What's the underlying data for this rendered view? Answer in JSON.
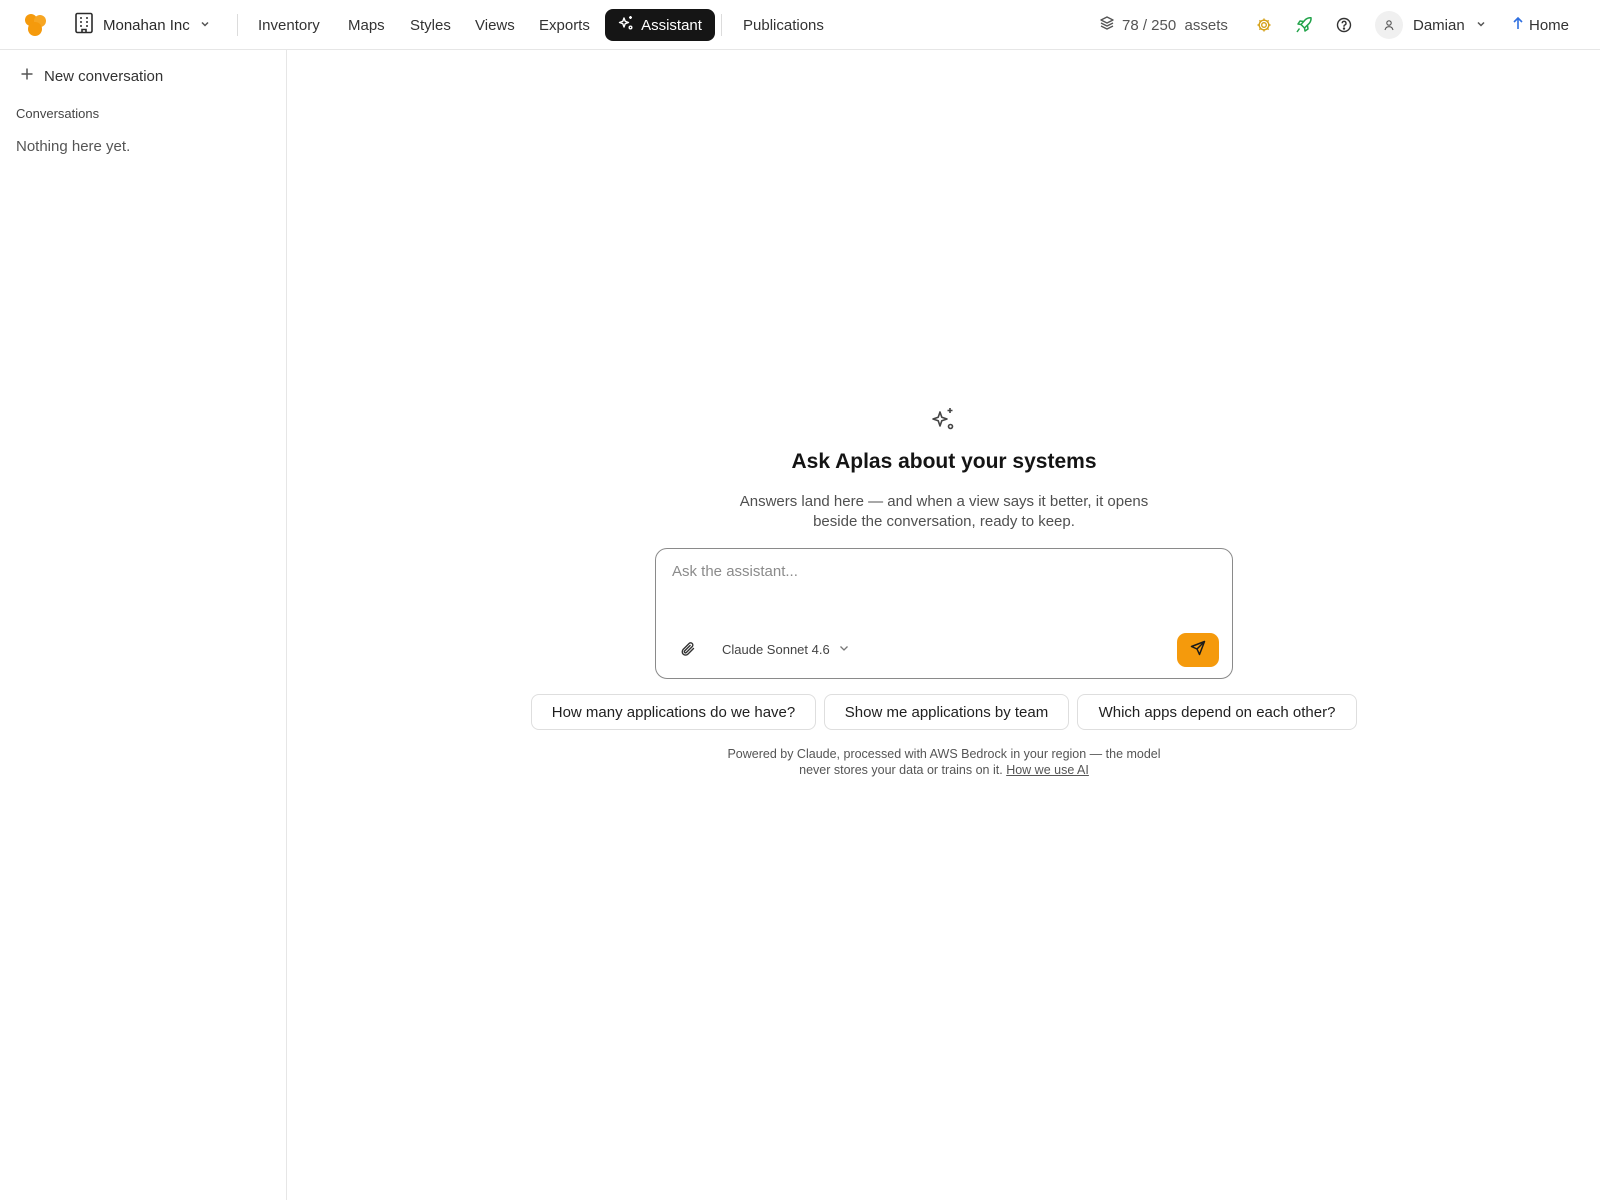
{
  "header": {
    "org_name": "Monahan Inc",
    "nav": [
      {
        "label": "Inventory"
      },
      {
        "label": "Maps"
      },
      {
        "label": "Styles"
      },
      {
        "label": "Views"
      },
      {
        "label": "Exports"
      },
      {
        "label": "Assistant",
        "active": true
      },
      {
        "label": "Publications"
      }
    ],
    "assets_text": "78 / 250  assets",
    "user_name": "Damian",
    "home_label": "Home",
    "icons": [
      "logo-icon",
      "building-icon",
      "chevron-down-icon",
      "sparkle-icon",
      "layers-icon",
      "gear-icon",
      "rocket-icon",
      "help-icon",
      "user-icon",
      "arrow-up-icon"
    ]
  },
  "sidebar": {
    "new_conversation": "New conversation",
    "section_title": "Conversations",
    "empty_text": "Nothing here yet."
  },
  "main": {
    "headline": "Ask Aplas about your systems",
    "subtitle": "Answers land here — and when a view says it better, it opens beside the conversation, ready to keep.",
    "input_placeholder": "Ask the assistant...",
    "model_label": "Claude Sonnet 4.6",
    "suggestions": [
      "How many applications do we have?",
      "Show me applications by team",
      "Which apps depend on each other?"
    ],
    "footer_text": "Powered by Claude, processed with AWS Bedrock in your region — the model never stores your data or trains on it.",
    "footer_link": "How we use AI"
  },
  "colors": {
    "accent": "#f59a0c",
    "active_nav_bg": "#151515",
    "rocket": "#22a34a",
    "gear": "#d4a017",
    "home_arrow": "#2f6fe0"
  }
}
